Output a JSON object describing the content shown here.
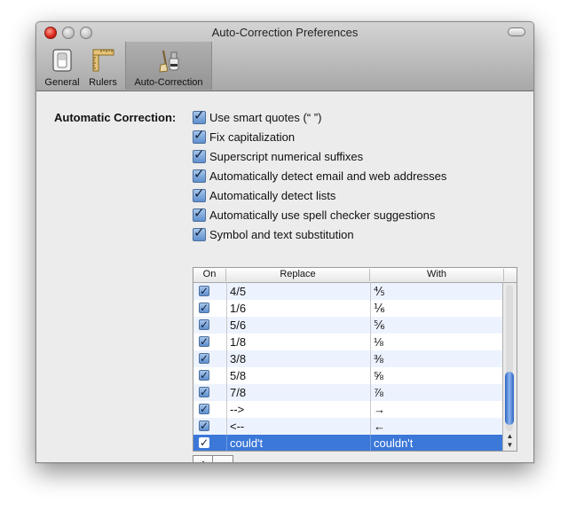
{
  "window": {
    "title": "Auto-Correction Preferences"
  },
  "toolbar": {
    "items": [
      {
        "label": "General",
        "icon": "general-switch-icon"
      },
      {
        "label": "Rulers",
        "icon": "rulers-icon"
      },
      {
        "label": "Auto-Correction",
        "icon": "auto-correction-icon",
        "selected": true
      }
    ]
  },
  "section": {
    "label": "Automatic Correction:"
  },
  "options": [
    {
      "label": "Use smart quotes (“ ”)",
      "checked": true
    },
    {
      "label": "Fix capitalization",
      "checked": true
    },
    {
      "label": "Superscript numerical suffixes",
      "checked": true
    },
    {
      "label": "Automatically detect email and web addresses",
      "checked": true
    },
    {
      "label": "Automatically detect lists",
      "checked": true
    },
    {
      "label": "Automatically use spell checker suggestions",
      "checked": true
    },
    {
      "label": "Symbol and text substitution",
      "checked": true
    }
  ],
  "table": {
    "headers": {
      "on": "On",
      "replace": "Replace",
      "with": "With"
    },
    "rows": [
      {
        "replace": "4/5",
        "with": "⅘"
      },
      {
        "replace": "1/6",
        "with": "⅙"
      },
      {
        "replace": "5/6",
        "with": "⅚"
      },
      {
        "replace": "1/8",
        "with": "⅛"
      },
      {
        "replace": "3/8",
        "with": "⅜"
      },
      {
        "replace": "5/8",
        "with": "⅝"
      },
      {
        "replace": "7/8",
        "with": "⅞"
      },
      {
        "replace": "-->",
        "with": "→"
      },
      {
        "replace": "<--",
        "with": "←"
      },
      {
        "replace": "could't",
        "with": "couldn't",
        "selected": true
      }
    ]
  },
  "buttons": {
    "add": "+",
    "remove": "−"
  },
  "colors": {
    "selection": "#3b78d8",
    "checkbox": "#5f90cf",
    "alt_row": "#edf3fe"
  }
}
